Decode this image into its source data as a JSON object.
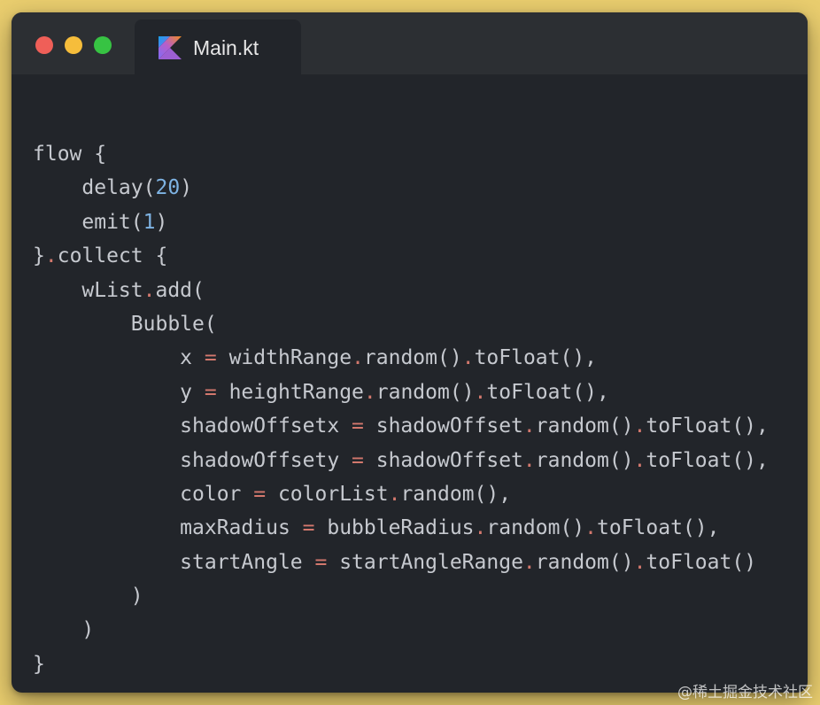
{
  "window": {
    "tab": {
      "label": "Main.kt",
      "icon": "kotlin-logo-icon"
    },
    "traffic_lights": {
      "close": "#ef5f58",
      "minimize": "#f6bd3b",
      "maximize": "#37c343"
    }
  },
  "colors": {
    "background": "#e9cd6e",
    "editor": "#22252a",
    "titlebar": "#2c2f33",
    "text": "#c6c9cf",
    "number": "#7eb3e3",
    "dot_operator": "#d3786d"
  },
  "code_lines": [
    [
      {
        "t": "flow {",
        "k": "plain"
      }
    ],
    [
      {
        "t": "    delay(",
        "k": "plain"
      },
      {
        "t": "20",
        "k": "num"
      },
      {
        "t": ")",
        "k": "plain"
      }
    ],
    [
      {
        "t": "    emit(",
        "k": "plain"
      },
      {
        "t": "1",
        "k": "num"
      },
      {
        "t": ")",
        "k": "plain"
      }
    ],
    [
      {
        "t": "}",
        "k": "plain"
      },
      {
        "t": ".",
        "k": "punc"
      },
      {
        "t": "collect {",
        "k": "plain"
      }
    ],
    [
      {
        "t": "    wList",
        "k": "plain"
      },
      {
        "t": ".",
        "k": "punc"
      },
      {
        "t": "add(",
        "k": "plain"
      }
    ],
    [
      {
        "t": "        Bubble(",
        "k": "plain"
      }
    ],
    [
      {
        "t": "            x ",
        "k": "plain"
      },
      {
        "t": "=",
        "k": "punc"
      },
      {
        "t": " widthRange",
        "k": "plain"
      },
      {
        "t": ".",
        "k": "punc"
      },
      {
        "t": "random()",
        "k": "plain"
      },
      {
        "t": ".",
        "k": "punc"
      },
      {
        "t": "toFloat(),",
        "k": "plain"
      }
    ],
    [
      {
        "t": "            y ",
        "k": "plain"
      },
      {
        "t": "=",
        "k": "punc"
      },
      {
        "t": " heightRange",
        "k": "plain"
      },
      {
        "t": ".",
        "k": "punc"
      },
      {
        "t": "random()",
        "k": "plain"
      },
      {
        "t": ".",
        "k": "punc"
      },
      {
        "t": "toFloat(),",
        "k": "plain"
      }
    ],
    [
      {
        "t": "            shadowOffsetx ",
        "k": "plain"
      },
      {
        "t": "=",
        "k": "punc"
      },
      {
        "t": " shadowOffset",
        "k": "plain"
      },
      {
        "t": ".",
        "k": "punc"
      },
      {
        "t": "random()",
        "k": "plain"
      },
      {
        "t": ".",
        "k": "punc"
      },
      {
        "t": "toFloat(),",
        "k": "plain"
      }
    ],
    [
      {
        "t": "            shadowOffsety ",
        "k": "plain"
      },
      {
        "t": "=",
        "k": "punc"
      },
      {
        "t": " shadowOffset",
        "k": "plain"
      },
      {
        "t": ".",
        "k": "punc"
      },
      {
        "t": "random()",
        "k": "plain"
      },
      {
        "t": ".",
        "k": "punc"
      },
      {
        "t": "toFloat(),",
        "k": "plain"
      }
    ],
    [
      {
        "t": "            color ",
        "k": "plain"
      },
      {
        "t": "=",
        "k": "punc"
      },
      {
        "t": " colorList",
        "k": "plain"
      },
      {
        "t": ".",
        "k": "punc"
      },
      {
        "t": "random(),",
        "k": "plain"
      }
    ],
    [
      {
        "t": "            maxRadius ",
        "k": "plain"
      },
      {
        "t": "=",
        "k": "punc"
      },
      {
        "t": " bubbleRadius",
        "k": "plain"
      },
      {
        "t": ".",
        "k": "punc"
      },
      {
        "t": "random()",
        "k": "plain"
      },
      {
        "t": ".",
        "k": "punc"
      },
      {
        "t": "toFloat(),",
        "k": "plain"
      }
    ],
    [
      {
        "t": "            startAngle ",
        "k": "plain"
      },
      {
        "t": "=",
        "k": "punc"
      },
      {
        "t": " startAngleRange",
        "k": "plain"
      },
      {
        "t": ".",
        "k": "punc"
      },
      {
        "t": "random()",
        "k": "plain"
      },
      {
        "t": ".",
        "k": "punc"
      },
      {
        "t": "toFloat()",
        "k": "plain"
      }
    ],
    [
      {
        "t": "        )",
        "k": "plain"
      }
    ],
    [
      {
        "t": "    )",
        "k": "plain"
      }
    ],
    [
      {
        "t": "}",
        "k": "plain"
      }
    ]
  ],
  "watermark": "@稀土掘金技术社区"
}
